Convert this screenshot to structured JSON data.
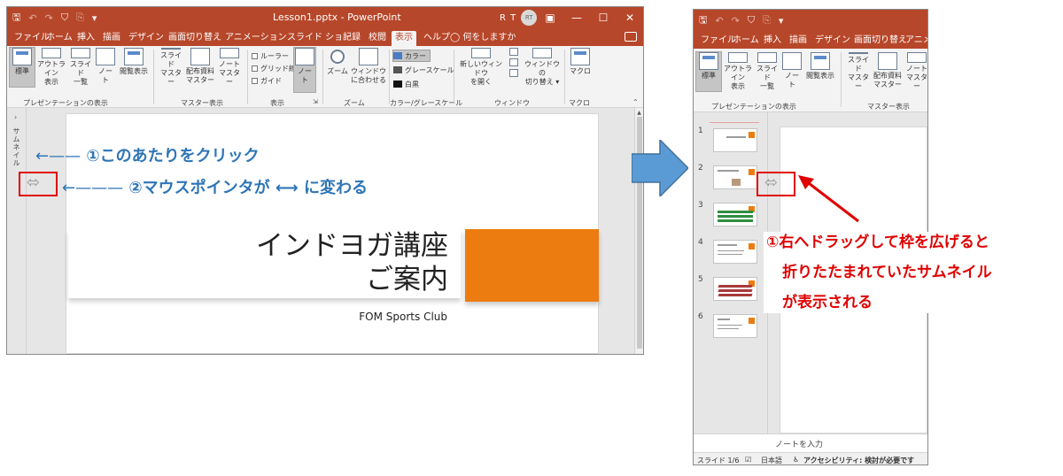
{
  "window1": {
    "qat": [
      "🖫",
      "↶",
      "↷",
      "⛉",
      "⎘",
      "▾"
    ],
    "title": "Lesson1.pptx  -  PowerPoint",
    "user_initials": "R T",
    "avatar_text": "RT",
    "controls": [
      "▣",
      "—",
      "☐",
      "✕"
    ],
    "tabs": [
      "ファイル",
      "ホーム",
      "挿入",
      "描画",
      "デザイン",
      "画面切り替え",
      "アニメーション",
      "スライド ショー",
      "記録",
      "校閲",
      "表示",
      "ヘルプ",
      "何をしますか"
    ],
    "ribbon": {
      "btn_standard": "標準",
      "btn_outline": "アウトライン\n表示",
      "btn_sorter": "スライド\n一覧",
      "btn_notes": "ノー\nト",
      "btn_reading": "閲覧表示",
      "btn_slide_master": "スライド\nマスター",
      "btn_handout_master": "配布資料\nマスター",
      "btn_notes_master": "ノート\nマスター",
      "chk_ruler": "ルーラー",
      "chk_grid": "グリッド線",
      "chk_guide": "ガイド",
      "btn_notes2": "ノー\nト",
      "btn_zoom": "ズーム",
      "btn_fit": "ウィンドウ\nに合わせる",
      "color": "カラー",
      "grayscale": "グレースケール",
      "bw": "白黒",
      "btn_new_window": "新しいウィンドウ\nを開く",
      "btn_switch_window": "ウィンドウの\n切り替え ▾",
      "btn_macro": "マクロ",
      "group_pres_views": "プレゼンテーションの表示",
      "group_master_views": "マスター表示",
      "group_show": "表示",
      "group_zoom": "ズーム",
      "group_color": "カラー/グレースケール",
      "group_window": "ウィンドウ",
      "group_macro": "マクロ"
    },
    "thumb_label": "サムネイル",
    "slide": {
      "title": "インドヨガ講座\nご案内",
      "subtitle": "FOM Sports Club"
    }
  },
  "annotations_left": {
    "step1": "①このあたりをクリック",
    "step2_pre": "②マウスポインタが",
    "step2_arrow": "⟷",
    "step2_post": "に変わる"
  },
  "window2": {
    "tabs": [
      "ファイル",
      "ホーム",
      "挿入",
      "描画",
      "デザイン",
      "画面切り替え",
      "アニメー"
    ],
    "ribbon": {
      "btn_standard": "標準",
      "btn_outline": "アウトライン\n表示",
      "btn_sorter": "スライド\n一覧",
      "btn_notes": "ノー\nト",
      "btn_reading": "閲覧表示",
      "btn_slide_master": "スライド\nマスター",
      "btn_handout_master": "配布資料\nマスター",
      "btn_notes_master": "ノート\nマスター",
      "group_pres_views": "プレゼンテーションの表示",
      "group_master_views": "マスター表示"
    },
    "slide_numbers": [
      "1",
      "2",
      "3",
      "4",
      "5",
      "6"
    ],
    "notes_placeholder": "ノートを入力",
    "status": {
      "slide": "スライド 1/6",
      "lang": "日本語",
      "accessibility": "アクセシビリティ: 検討が必要です"
    }
  },
  "annotations_right": {
    "line1": "①右へドラッグして枠を広げると",
    "line2": "折りたたまれていたサムネイル",
    "line3": "が表示される"
  },
  "colors": {
    "title_bar": "#b7472a",
    "annotation_blue": "#2e75b6",
    "annotation_red": "#e00000",
    "slide_orange": "#ec7c0f",
    "transition_arrow": "#5b9bd5"
  }
}
